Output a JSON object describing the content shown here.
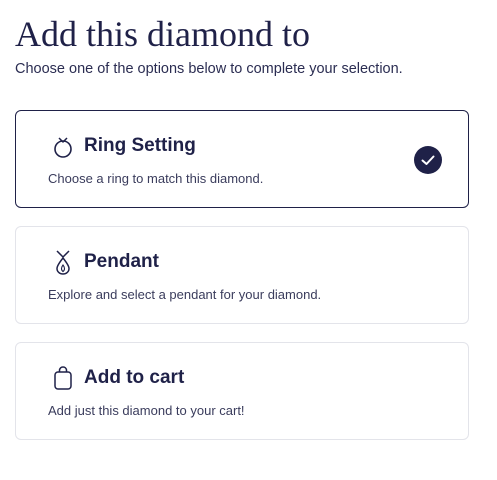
{
  "header": {
    "title": "Add this diamond to",
    "subtitle": "Choose one of the options below to complete your selection."
  },
  "options": [
    {
      "label": "Ring Setting",
      "description": "Choose a ring to match this diamond.",
      "icon": "ring-icon",
      "selected": true
    },
    {
      "label": "Pendant",
      "description": "Explore and select a pendant for your diamond.",
      "icon": "pendant-icon",
      "selected": false
    },
    {
      "label": "Add to cart",
      "description": "Add just this diamond to your cart!",
      "icon": "shopping-bag-icon",
      "selected": false
    }
  ],
  "colors": {
    "primary": "#1f2148",
    "border": "#e3e4ea",
    "background": "#ffffff"
  }
}
